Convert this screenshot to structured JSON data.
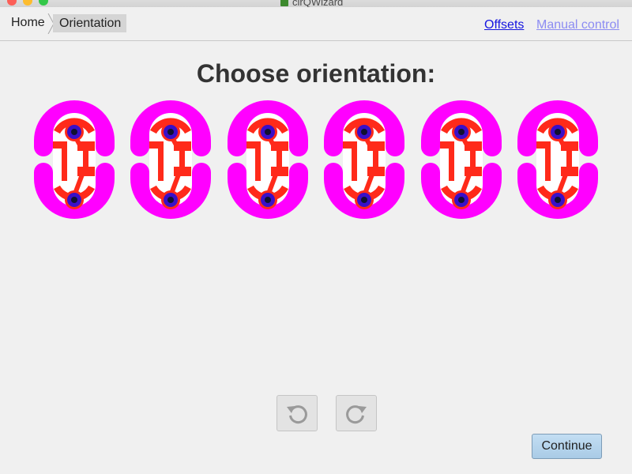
{
  "window": {
    "title": "cirQWizard"
  },
  "breadcrumb": {
    "home": "Home",
    "current": "Orientation"
  },
  "nav_links": {
    "offsets": "Offsets",
    "manual_control": "Manual control"
  },
  "heading": "Choose orientation:",
  "orientation_count": 6,
  "controls": {
    "rotate_left_icon": "rotate-counterclockwise-icon",
    "rotate_right_icon": "rotate-clockwise-icon",
    "continue_label": "Continue"
  },
  "colors": {
    "board_outline": "#ff00ff",
    "traces": "#ff2a1a",
    "pads": "#3a10c8",
    "drill": "#101030",
    "continue_button": "#b5d3ec",
    "link": "#1515e0",
    "link_disabled": "#8c8cf2"
  }
}
